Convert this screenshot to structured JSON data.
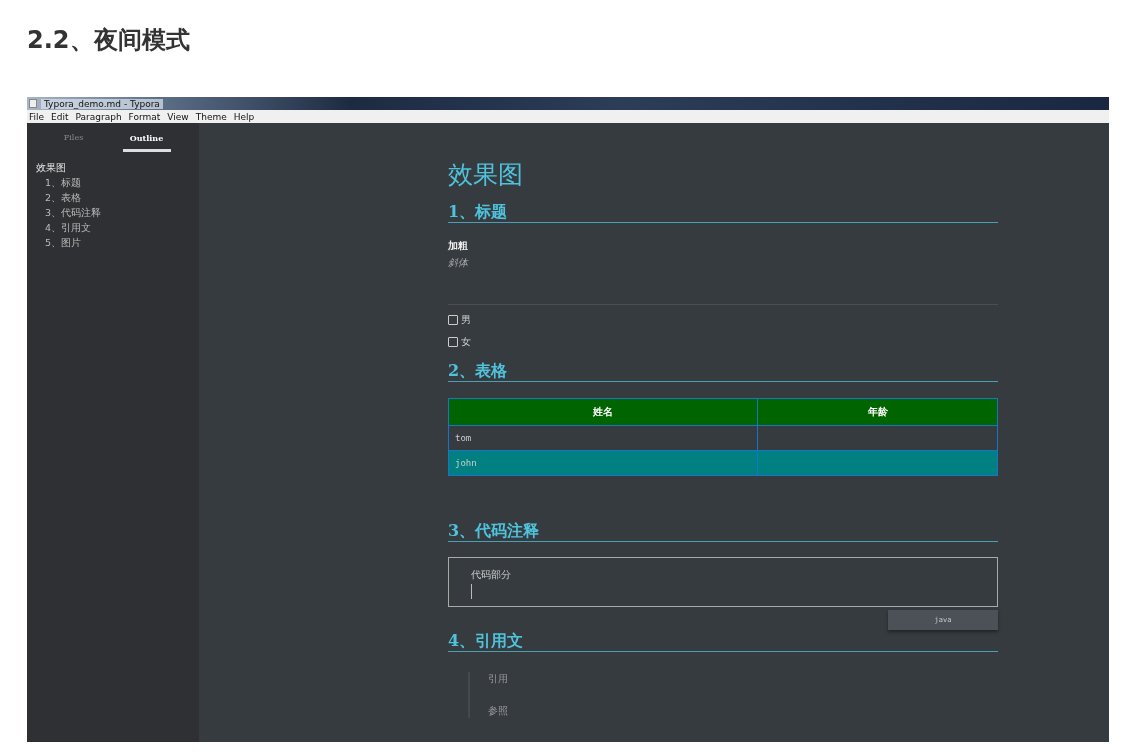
{
  "page_heading": "2.2、夜间模式",
  "window": {
    "title": "Typora_demo.md - Typora"
  },
  "menu": [
    "File",
    "Edit",
    "Paragraph",
    "Format",
    "View",
    "Theme",
    "Help"
  ],
  "sidebar": {
    "tabs": [
      {
        "label": "Files",
        "selected": false
      },
      {
        "label": "Outline",
        "selected": true
      }
    ],
    "outline": [
      {
        "label": "效果图",
        "children": [
          {
            "label": "1、标题"
          },
          {
            "label": "2、表格"
          },
          {
            "label": "3、代码注释"
          },
          {
            "label": "4、引用文"
          },
          {
            "label": "5、图片"
          }
        ]
      }
    ]
  },
  "document": {
    "title": "效果图",
    "sections": [
      {
        "heading": "1、标题",
        "blocks": [
          {
            "kind": "bold",
            "text": "加粗"
          },
          {
            "kind": "italic",
            "text": "斜体"
          },
          {
            "kind": "rule"
          },
          {
            "kind": "task",
            "text": "男",
            "checked": false
          },
          {
            "kind": "task",
            "text": "女",
            "checked": false
          }
        ]
      },
      {
        "heading": "2、表格",
        "blocks": [
          {
            "kind": "table",
            "columns": [
              "姓名",
              "年龄"
            ],
            "rows": [
              {
                "name": "tom",
                "highlighted": false
              },
              {
                "name": "john",
                "highlighted": true
              }
            ]
          }
        ]
      },
      {
        "heading": "3、代码注释",
        "blocks": [
          {
            "kind": "code",
            "code": "代码部分",
            "language": "java"
          }
        ]
      },
      {
        "heading": "4、引用文",
        "blocks": [
          {
            "kind": "quote",
            "lines": [
              "引用",
              "参照"
            ]
          }
        ]
      }
    ]
  }
}
